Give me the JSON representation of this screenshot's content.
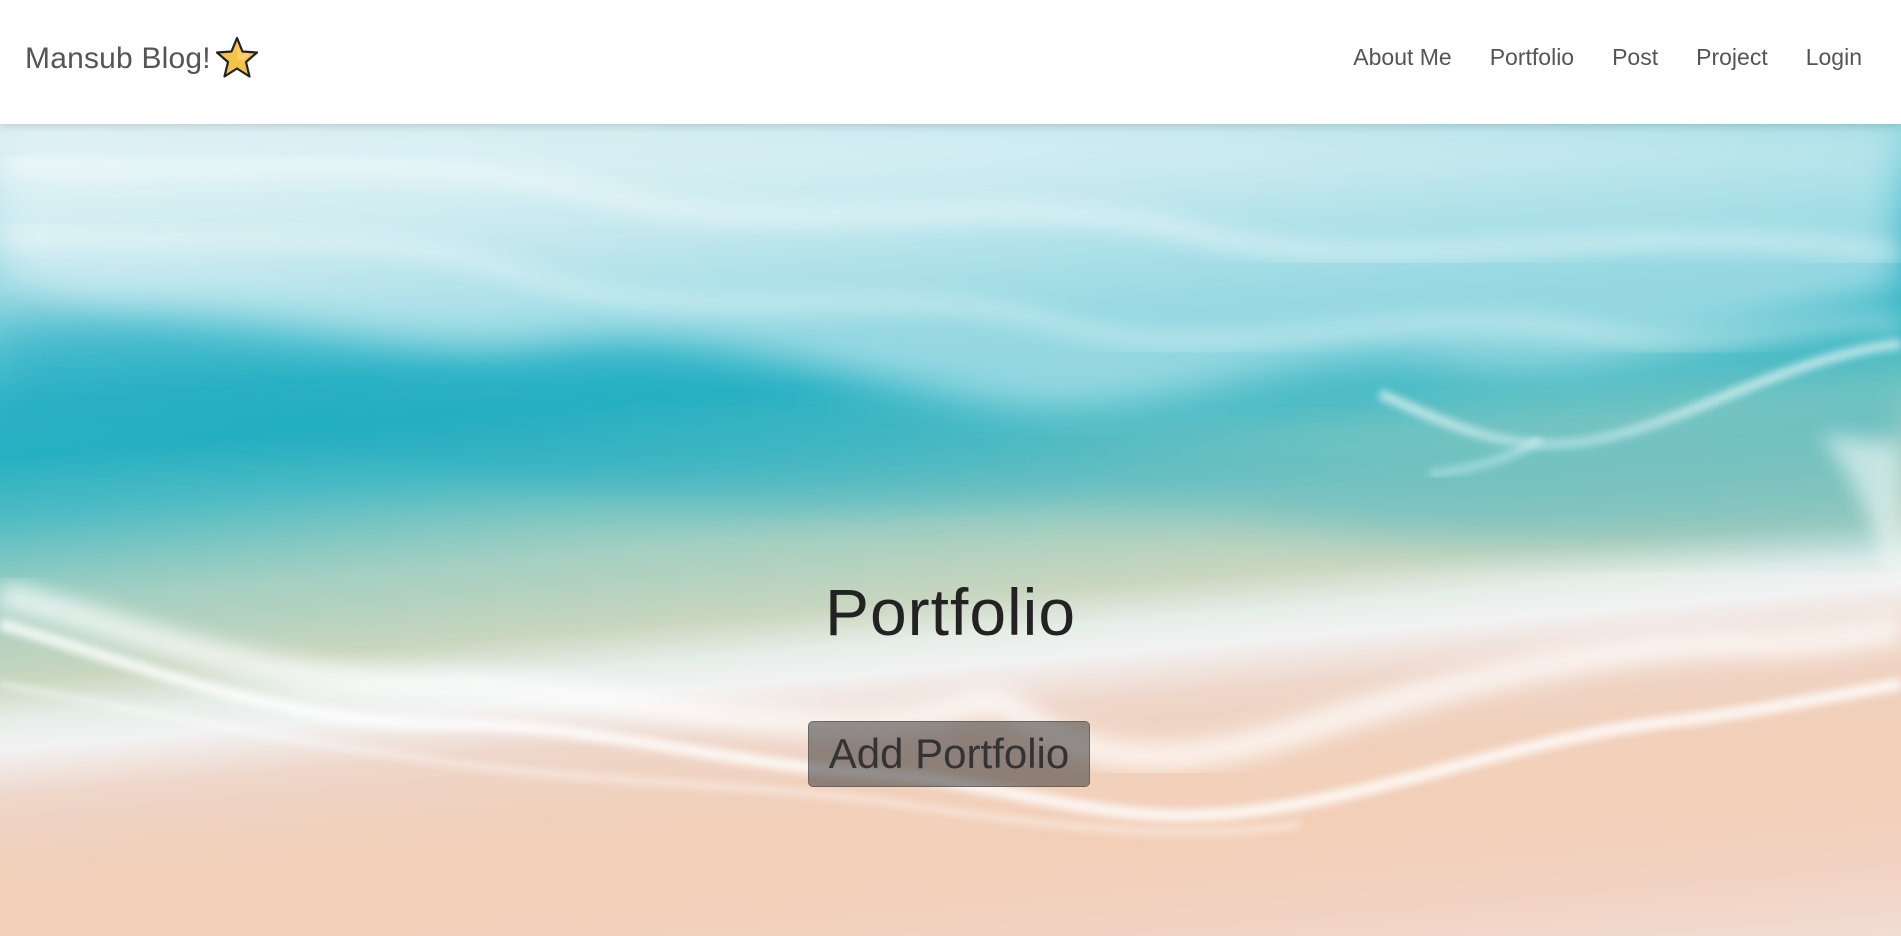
{
  "navbar": {
    "brand": "Mansub Blog!",
    "brand_icon": "star-icon",
    "links": [
      {
        "label": "About Me"
      },
      {
        "label": "Portfolio"
      },
      {
        "label": "Post"
      },
      {
        "label": "Project"
      },
      {
        "label": "Login"
      }
    ]
  },
  "hero": {
    "background": "aerial-beach-waves-photo",
    "title": "Portfolio",
    "button_label": "Add Portfolio"
  },
  "colors": {
    "nav_text": "#555555",
    "star_fill": "#f5c24a",
    "star_outline": "#222222",
    "button_bg": "rgba(60,60,60,0.55)"
  }
}
